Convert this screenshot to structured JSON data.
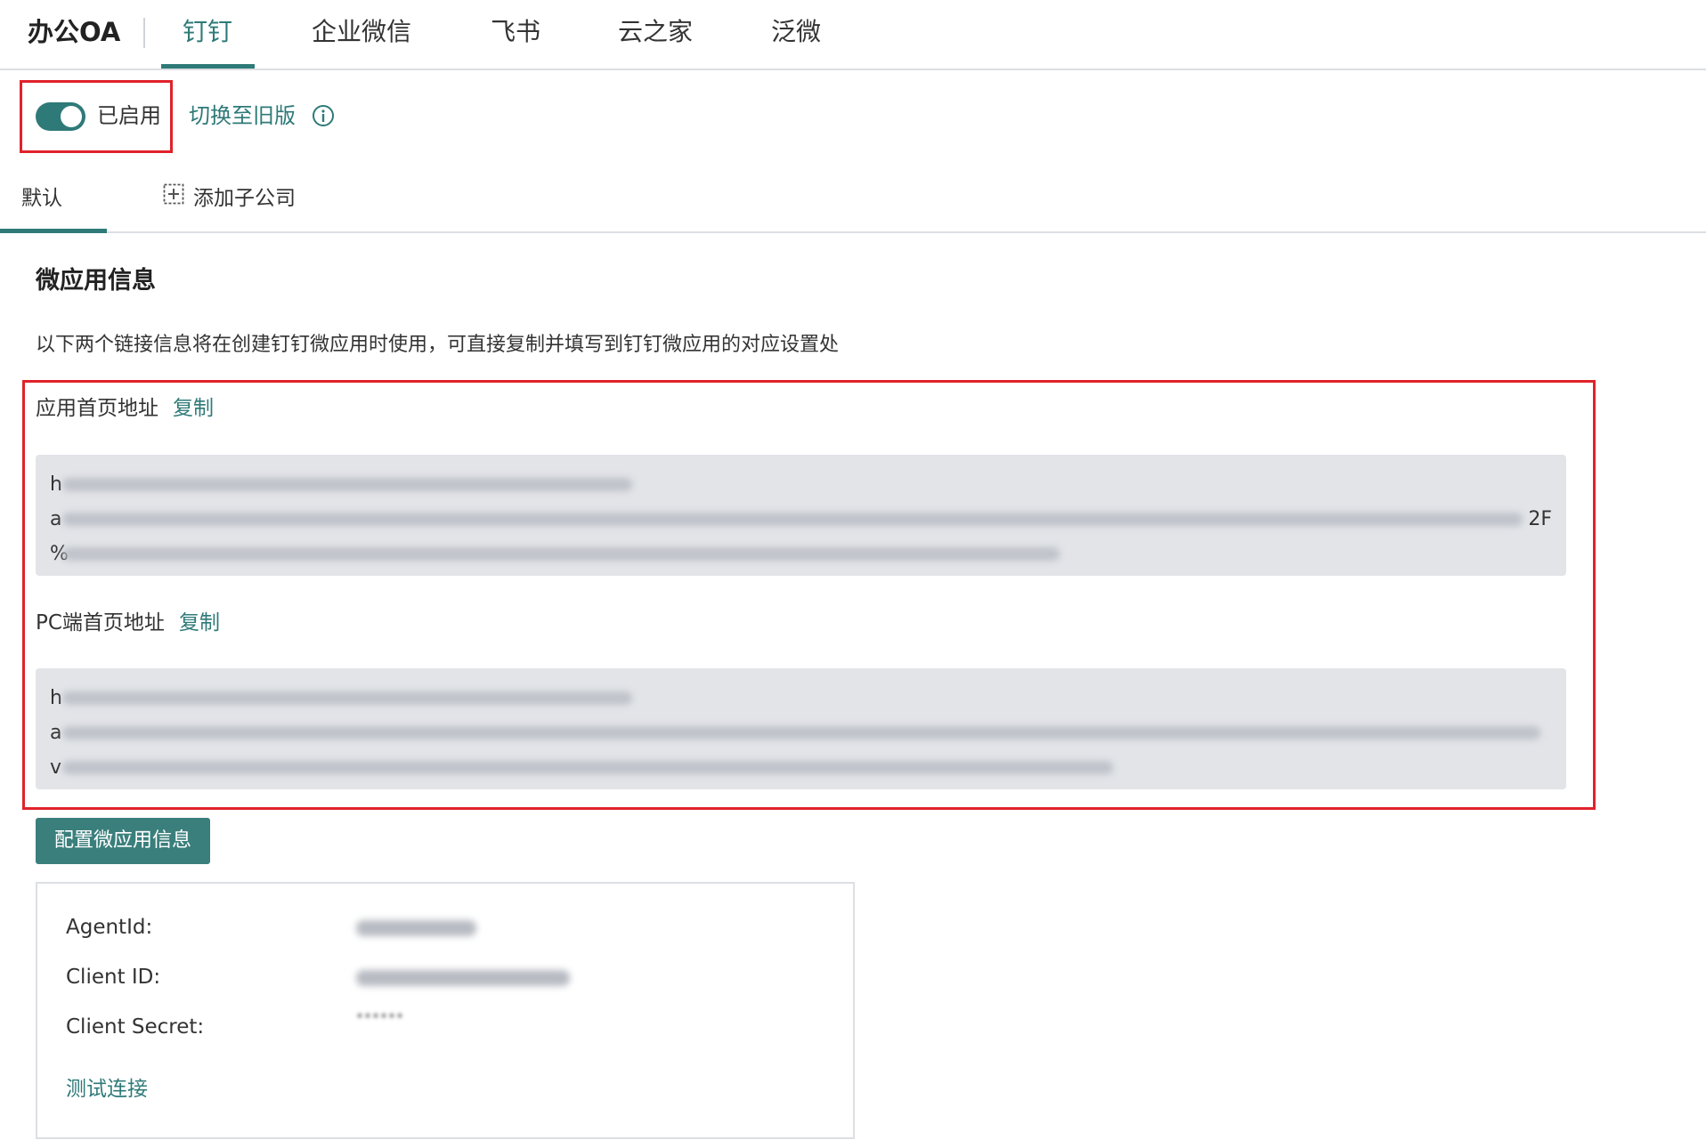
{
  "header": {
    "brand": "办公OA",
    "tabs": [
      {
        "label": "钉钉",
        "active": true
      },
      {
        "label": "企业微信",
        "active": false
      },
      {
        "label": "飞书",
        "active": false
      },
      {
        "label": "云之家",
        "active": false
      },
      {
        "label": "泛微",
        "active": false
      }
    ]
  },
  "status": {
    "enabled": true,
    "label": "已启用",
    "switch_link": "切换至旧版",
    "info_icon": "info-circle-icon"
  },
  "sub_tabs": {
    "default_label": "默认",
    "add_label": "添加子公司",
    "add_icon": "plus-square-icon"
  },
  "section": {
    "title": "微应用信息",
    "description": "以下两个链接信息将在创建钉钉微应用时使用，可直接复制并填写到钉钉微应用的对应设置处"
  },
  "fields": {
    "app_home": {
      "label": "应用首页地址",
      "copy_label": "复制",
      "visible_line_starts": [
        "h",
        "a",
        "%"
      ],
      "visible_line_end": "2F"
    },
    "pc_home": {
      "label": "PC端首页地址",
      "copy_label": "复制",
      "visible_line_starts": [
        "h",
        "a",
        "v"
      ]
    }
  },
  "config_button": "配置微应用信息",
  "credentials": {
    "agent_id_label": "AgentId:",
    "client_id_label": "Client ID:",
    "client_secret_label": "Client Secret:",
    "client_secret_value": "******",
    "test_link": "测试连接"
  },
  "colors": {
    "accent": "#2e7a78",
    "button": "#3a7f7c",
    "highlight_border": "#e0222a",
    "url_box_bg": "#e2e4e8"
  }
}
